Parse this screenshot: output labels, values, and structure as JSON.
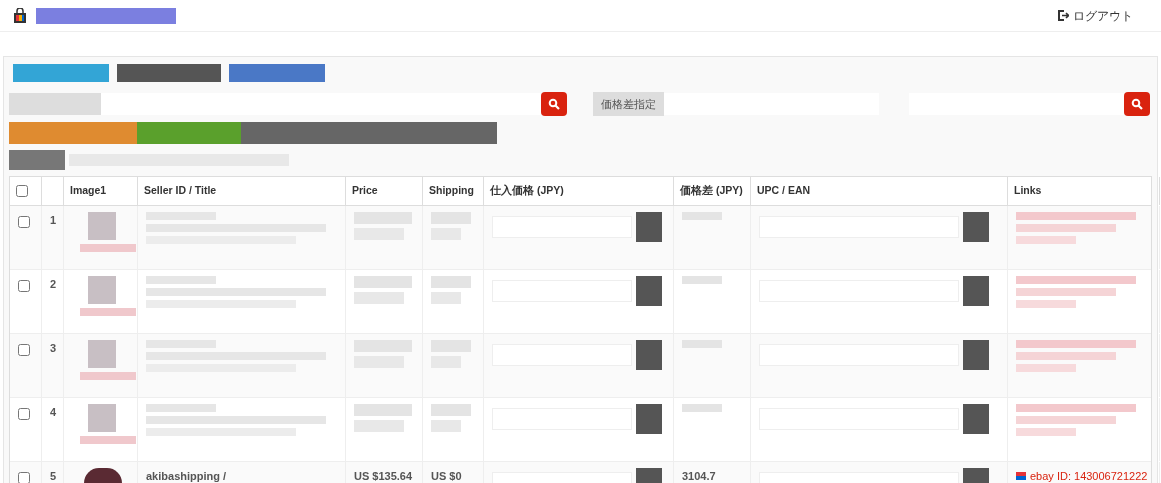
{
  "header": {
    "logout": "ログアウト"
  },
  "filters": {
    "price_diff_label": "価格差指定"
  },
  "table": {
    "select_all_checked": false,
    "columns": [
      {
        "kind": "check"
      },
      {
        "kind": "num"
      },
      {
        "label": "Image1",
        "kind": "image"
      },
      {
        "label": "Seller ID / Title",
        "kind": "seller"
      },
      {
        "label": "Price",
        "kind": "price"
      },
      {
        "label": "Shipping",
        "kind": "shipping"
      },
      {
        "label": "仕入価格 (JPY)",
        "kind": "cost"
      },
      {
        "label": "価格差 (JPY)",
        "kind": "diff"
      },
      {
        "label": "UPC / EAN",
        "kind": "upc"
      },
      {
        "label": "Links",
        "kind": "links"
      }
    ],
    "rows": [
      {
        "number": "1",
        "checked": false
      },
      {
        "number": "2",
        "checked": false
      },
      {
        "number": "3",
        "checked": false
      },
      {
        "number": "4",
        "checked": false
      },
      {
        "number": "5",
        "checked": false,
        "seller": "akibashipping /",
        "price": "US $135.64",
        "shipping": "US $0",
        "price_diff": "3104.7",
        "link": "ebay ID: 143006721222"
      }
    ]
  }
}
